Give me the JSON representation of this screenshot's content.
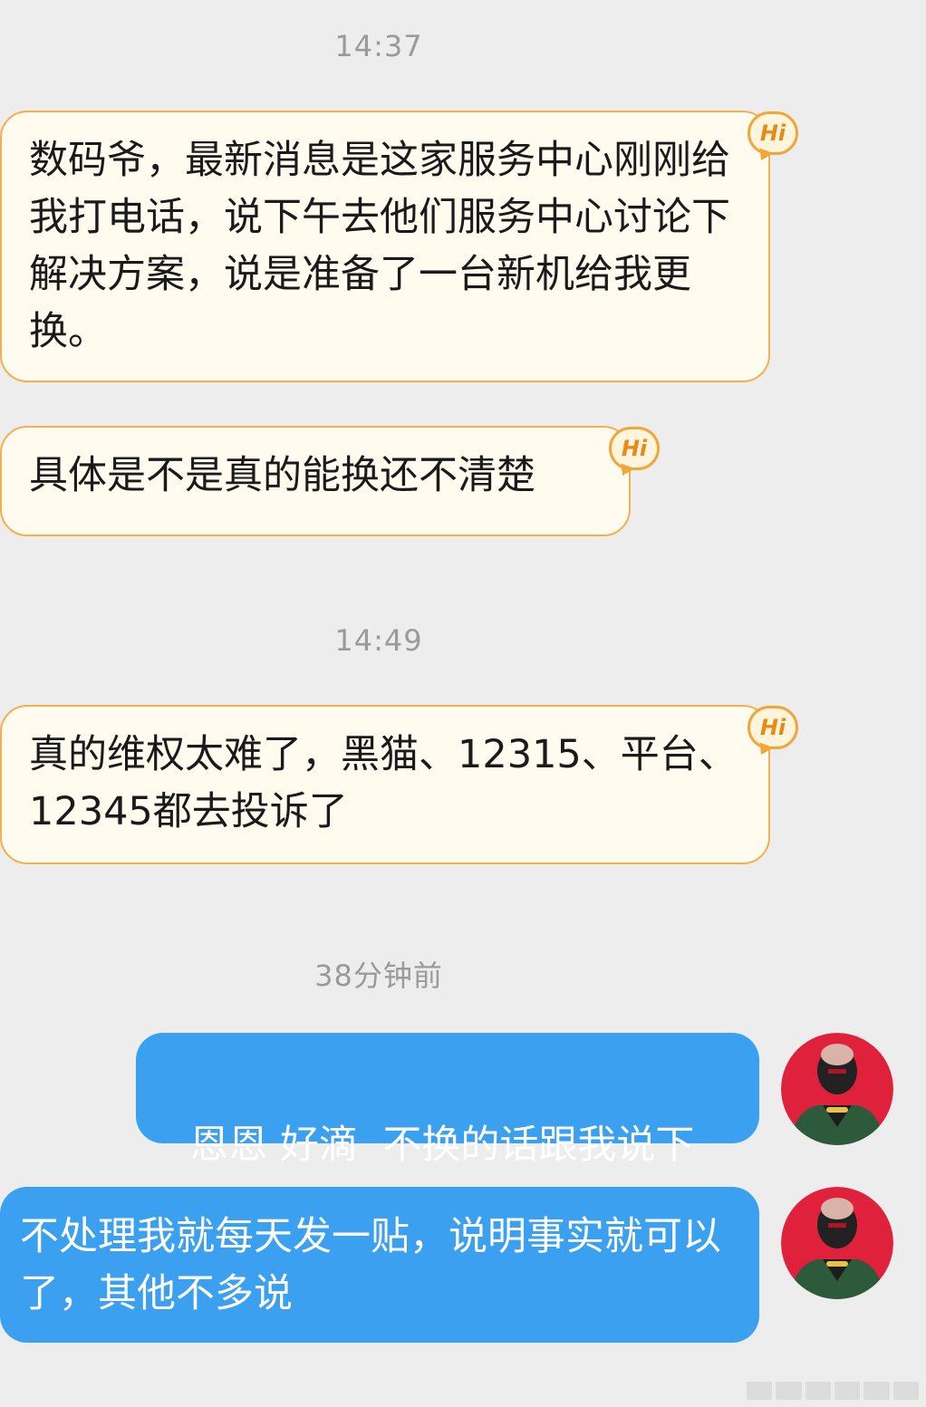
{
  "messages": [
    {
      "type": "timestamp",
      "text": "14:37"
    },
    {
      "type": "incoming",
      "text": "数码爷，最新消息是这家服务中心刚刚给我打电话，说下午去他们服务中心讨论下解决方案，说是准备了一台新机给我更换。",
      "badge": "Hi"
    },
    {
      "type": "incoming",
      "text": "具体是不是真的能换还不清楚",
      "badge": "Hi"
    },
    {
      "type": "timestamp",
      "text": "14:49"
    },
    {
      "type": "incoming",
      "text": "真的维权太难了，黑猫、12315、平台、12345都去投诉了",
      "badge": "Hi"
    },
    {
      "type": "timestamp",
      "text": "38分钟前"
    },
    {
      "type": "outgoing",
      "text": "恩恩 好滴  不换的话跟我说下"
    },
    {
      "type": "outgoing",
      "text": "不处理我就每天发一贴，说明事实就可以了，其他不多说"
    }
  ],
  "colors": {
    "background": "#ededed",
    "incoming_bubble": "#fffbef",
    "incoming_border": "#f2b04f",
    "outgoing_bubble": "#3aa0ef",
    "timestamp_text": "#9a9a9a",
    "avatar_bg": "#e0213c"
  },
  "icons": {
    "hi_badge": "hi-badge-icon",
    "avatar": "user-avatar"
  }
}
